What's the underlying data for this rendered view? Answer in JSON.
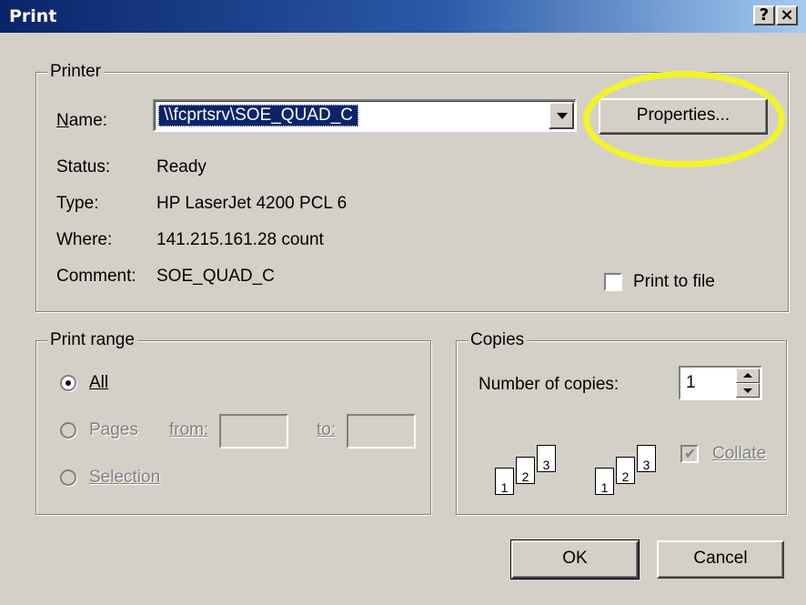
{
  "window": {
    "title": "Print",
    "help_label": "?",
    "close_label": "×"
  },
  "printer": {
    "legend": "Printer",
    "name_label": "Name:",
    "name_value": "\\\\fcprtsrv\\SOE_QUAD_C",
    "properties_button": "Properties...",
    "status_label": "Status:",
    "status_value": "Ready",
    "type_label": "Type:",
    "type_value": "HP LaserJet 4200 PCL 6",
    "where_label": "Where:",
    "where_value": "141.215.161.28 count",
    "comment_label": "Comment:",
    "comment_value": "SOE_QUAD_C",
    "print_to_file_label": "Print to file",
    "print_to_file_checked": false
  },
  "print_range": {
    "legend": "Print range",
    "all_label": "All",
    "pages_label": "Pages",
    "from_label": "from:",
    "to_label": "to:",
    "from_value": "",
    "to_value": "",
    "selection_label": "Selection",
    "selected": "All"
  },
  "copies": {
    "legend": "Copies",
    "number_label": "Number of copies:",
    "number_value": "1",
    "collate_label": "Collate",
    "collate_checked": true,
    "page_numbers": [
      "1",
      "2",
      "3"
    ]
  },
  "buttons": {
    "ok": "OK",
    "cancel": "Cancel"
  },
  "colors": {
    "titlebar": "#0a246a",
    "highlight": "#f3f32a",
    "dialog": "#d4d0c8"
  }
}
